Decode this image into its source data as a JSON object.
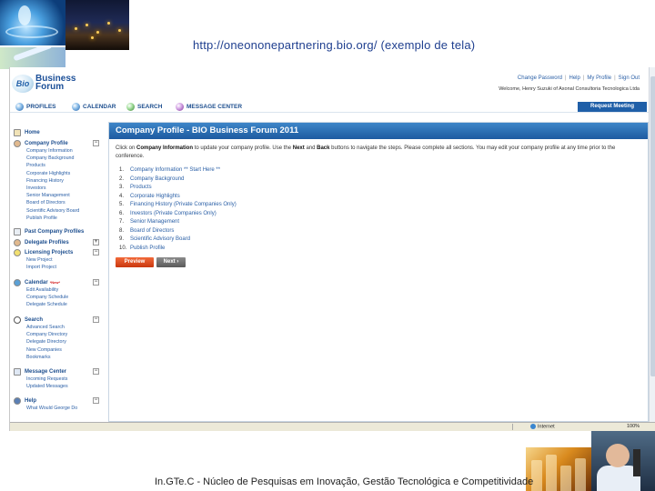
{
  "slide": {
    "url_caption": "http://oneononepartnering.bio.org/ (exemplo de tela)",
    "footer": "In.GTe.C - Núcleo de Pesquisas em Inovação, Gestão Tecnológica e Competitividade"
  },
  "header": {
    "logo_mark": "Bio",
    "logo_line1": "Business",
    "logo_line2": "Forum",
    "links": [
      "Change Password",
      "Help",
      "My Profile",
      "Sign Out"
    ],
    "welcome": "Welcome, Henry Suzuki of Axonal Consultoria Tecnologica Ltda"
  },
  "nav": {
    "items": [
      "PROFILES",
      "CALENDAR",
      "SEARCH",
      "MESSAGE CENTER"
    ],
    "request_meeting": "Request Meeting"
  },
  "sidebar": {
    "home": "Home",
    "company_profile": {
      "title": "Company Profile",
      "items": [
        "Company Information",
        "Company Background",
        "Products",
        "Corporate Highlights",
        "Financing History",
        "Investors",
        "Senior Management",
        "Board of Directors",
        "Scientific Advisory Board",
        "Publish Profile"
      ]
    },
    "past_profiles": "Past Company Profiles",
    "delegate_profiles": "Delegate Profiles",
    "licensing": {
      "title": "Licensing Projects",
      "items": [
        "New Project",
        "Import Project"
      ]
    },
    "calendar": {
      "title": "Calendar",
      "new_badge": "*New*",
      "items": [
        "Edit Availability",
        "Company Schedule",
        "Delegate Schedule"
      ]
    },
    "search": {
      "title": "Search",
      "items": [
        "Advanced Search",
        "Company Directory",
        "Delegate Directory",
        "New Companies",
        "Bookmarks"
      ]
    },
    "message_center": {
      "title": "Message Center",
      "items": [
        "Incoming Requests",
        "Updated Messages"
      ]
    },
    "help": {
      "title": "Help",
      "items": [
        "What Would George Do"
      ]
    }
  },
  "main": {
    "title": "Company Profile - BIO Business Forum 2011",
    "intro_pre": "Click on ",
    "intro_bold1": "Company Information",
    "intro_mid1": " to update your company profile. Use the ",
    "intro_bold2": "Next",
    "intro_mid2": " and ",
    "intro_bold3": "Back",
    "intro_post": " buttons to navigate the steps. Please complete all sections. You may edit your company profile at any time prior to the conference.",
    "steps": [
      {
        "num": "1.",
        "label": "Company Information ** Start Here **"
      },
      {
        "num": "2.",
        "label": "Company Background"
      },
      {
        "num": "3.",
        "label": "Products"
      },
      {
        "num": "4.",
        "label": "Corporate Highlights"
      },
      {
        "num": "5.",
        "label": "Financing History (Private Companies Only)"
      },
      {
        "num": "6.",
        "label": "Investors (Private Companies Only)"
      },
      {
        "num": "7.",
        "label": "Senior Management"
      },
      {
        "num": "8.",
        "label": "Board of Directors"
      },
      {
        "num": "9.",
        "label": "Scientific Advisory Board"
      },
      {
        "num": "10.",
        "label": "Publish Profile"
      }
    ],
    "preview_button": "Preview",
    "next_button": "Next ›"
  },
  "statusbar": {
    "zone": "Internet",
    "zoom": "100%"
  }
}
